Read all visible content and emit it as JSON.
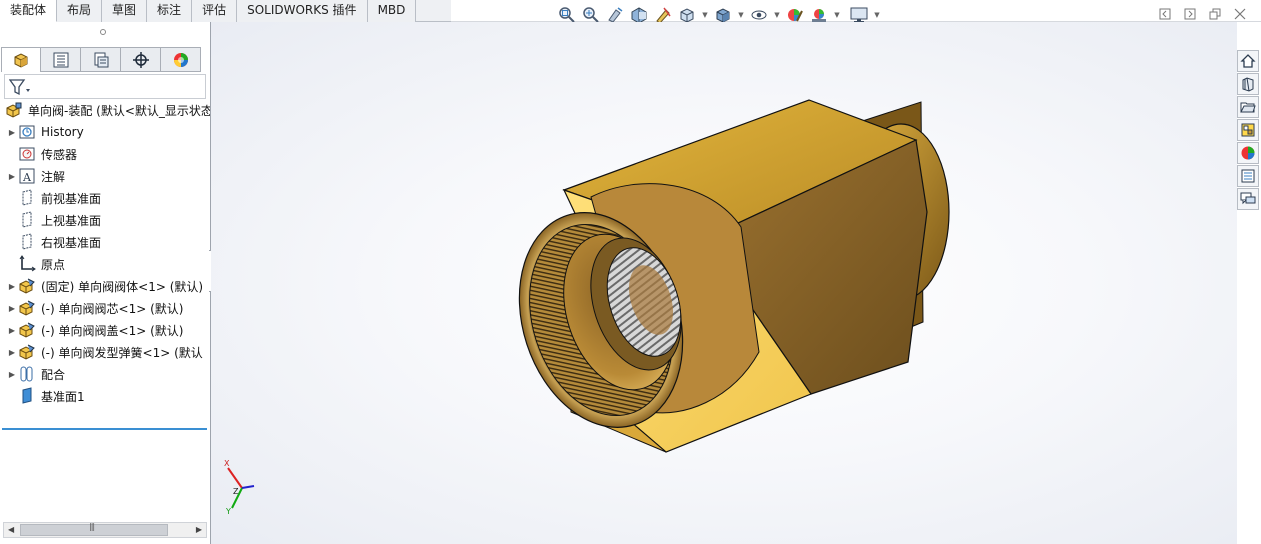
{
  "tabs": [
    {
      "label": "装配体"
    },
    {
      "label": "布局"
    },
    {
      "label": "草图"
    },
    {
      "label": "标注"
    },
    {
      "label": "评估"
    },
    {
      "label": "SOLIDWORKS 插件"
    },
    {
      "label": "MBD"
    }
  ],
  "view_toolbar": {
    "icons": [
      "zoom-to-fit-icon",
      "zoom-to-area-icon",
      "previous-view-icon",
      "section-view-icon",
      "dynamic-annotation-icon",
      "view-orientation-icon",
      "display-style-icon",
      "hide-show-icon",
      "edit-appearance-icon",
      "apply-scene-icon",
      "view-settings-icon"
    ]
  },
  "panel_tabs": [
    "featuremanager-icon",
    "propertymanager-icon",
    "configurationmanager-icon",
    "dimxpert-icon",
    "displaymanager-icon"
  ],
  "tree": {
    "root": "单向阀-装配  (默认<默认_显示状态",
    "items": [
      {
        "label": "History",
        "icon": "history-icon",
        "expandable": true
      },
      {
        "label": "传感器",
        "icon": "sensor-icon",
        "expandable": false
      },
      {
        "label": "注解",
        "icon": "annotation-icon",
        "expandable": true
      },
      {
        "label": "前视基准面",
        "icon": "plane-icon",
        "expandable": false
      },
      {
        "label": "上视基准面",
        "icon": "plane-icon",
        "expandable": false
      },
      {
        "label": "右视基准面",
        "icon": "plane-icon",
        "expandable": false
      },
      {
        "label": "原点",
        "icon": "origin-icon",
        "expandable": false
      },
      {
        "label": "(固定) 单向阀阀体<1> (默认)",
        "icon": "part-icon",
        "expandable": true
      },
      {
        "label": "(-) 单向阀阀芯<1> (默认)",
        "icon": "part-icon",
        "expandable": true
      },
      {
        "label": "(-) 单向阀阀盖<1> (默认)",
        "icon": "part-icon",
        "expandable": true
      },
      {
        "label": "(-) 单向阀发型弹簧<1> (默认",
        "icon": "part-icon",
        "expandable": true
      },
      {
        "label": "配合",
        "icon": "mates-icon",
        "expandable": true
      },
      {
        "label": "基准面1",
        "icon": "plane-solid-icon",
        "expandable": false
      }
    ]
  },
  "triad": {
    "x": "X",
    "y": "Y",
    "z": "Z"
  },
  "colors": {
    "brass_light": "#f0c653",
    "brass_mid": "#c7962d",
    "brass_dark": "#7d5a1c",
    "accent": "#3a8fd3"
  }
}
